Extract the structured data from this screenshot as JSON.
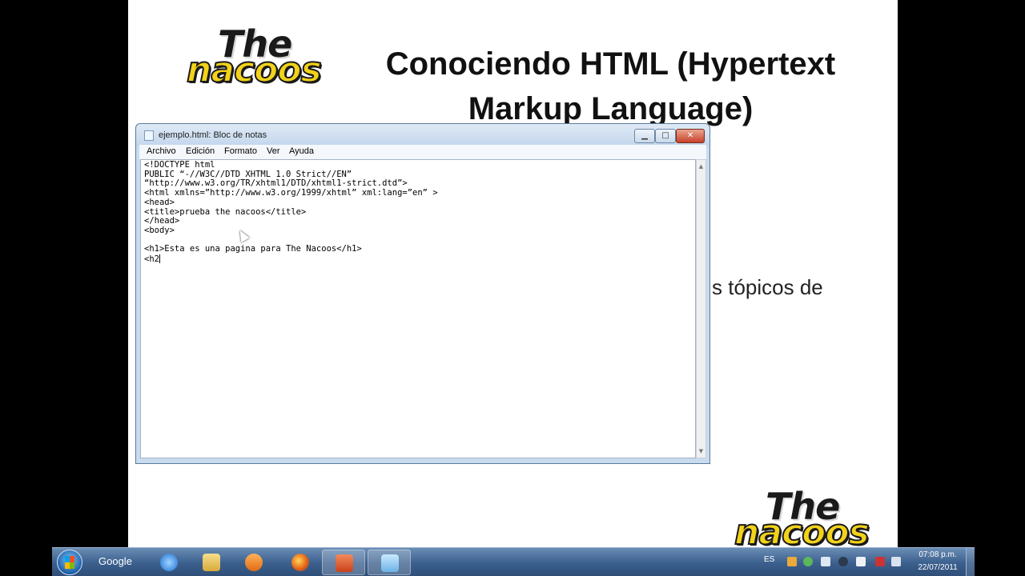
{
  "slide": {
    "logo_the": "The",
    "logo_nacoos": "nacoos",
    "title": "Conociendo HTML (Hypertext Markup Language)",
    "body_fragment": "s tópicos de"
  },
  "notepad": {
    "window_title": "ejemplo.html: Bloc de notas",
    "menu": {
      "archivo": "Archivo",
      "edicion": "Edición",
      "formato": "Formato",
      "ver": "Ver",
      "ayuda": "Ayuda"
    },
    "content": "<!DOCTYPE html\nPUBLIC “-//W3C//DTD XHTML 1.0 Strict//EN”\n“http://www.w3.org/TR/xhtml1/DTD/xhtml1-strict.dtd”>\n<html xmlns=”http://www.w3.org/1999/xhtml” xml:lang=”en” >\n<head>\n<title>prueba the nacoos</title>\n</head>\n<body>\n\n<h1>Esta es una pagina para The Nacoos</h1>\n<h2"
  },
  "taskbar": {
    "google_label": "Google",
    "language": "ES",
    "clock_time": "07:08 p.m.",
    "clock_date": "22/07/2011"
  },
  "icons": {
    "start": "windows-start-icon",
    "ie": "internet-explorer-icon",
    "explorer": "folder-icon",
    "media": "media-player-icon",
    "firefox": "firefox-icon",
    "powerpoint": "powerpoint-icon",
    "notepad": "notepad-icon"
  }
}
